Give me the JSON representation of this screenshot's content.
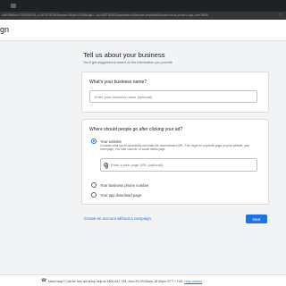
{
  "browser": {
    "url": "c0d0?86Aw=1703025970&_u=4070778750&source=0&uid=00248&ogb=...&u=4307304804&authuser=0&source=cmpBuild&id=new-ws-ac-pt-wst-u-sgb_ccm-ft6f3u",
    "star_icon": "☆"
  },
  "header": {
    "title": "gn"
  },
  "page": {
    "heading": "Tell us about your business",
    "subheading": "You'll get suggestions based on the information you provide"
  },
  "business_name": {
    "question": "What's your business name?",
    "placeholder": "Enter your business name (optional)"
  },
  "destination": {
    "question": "Where should people go after clicking your ad?",
    "options": [
      {
        "label": "Your website",
        "description": "Consider what you're advertising and enter the most relevant URL. This might be a specific page on your website, your homepage, YouTube channel, or social media page",
        "selected": true
      },
      {
        "label": "Your business phone number",
        "selected": false
      },
      {
        "label": "Your app download page",
        "selected": false
      }
    ],
    "url_placeholder": "Enter a web page URL (optional)"
  },
  "actions": {
    "campaign_link": "Create an account without a campaign",
    "next_label": "Next"
  },
  "footer": {
    "help_text": "Need help? Call for free ad setup help at 1800 612 781. Mon-Fri 09:00am-18:00pm GTT +7:00.",
    "help_link": "Help articles"
  },
  "colors": {
    "accent": "#1a73e8",
    "background": "#f1f3f4",
    "card": "#ffffff",
    "browser_chrome": "#202124"
  }
}
